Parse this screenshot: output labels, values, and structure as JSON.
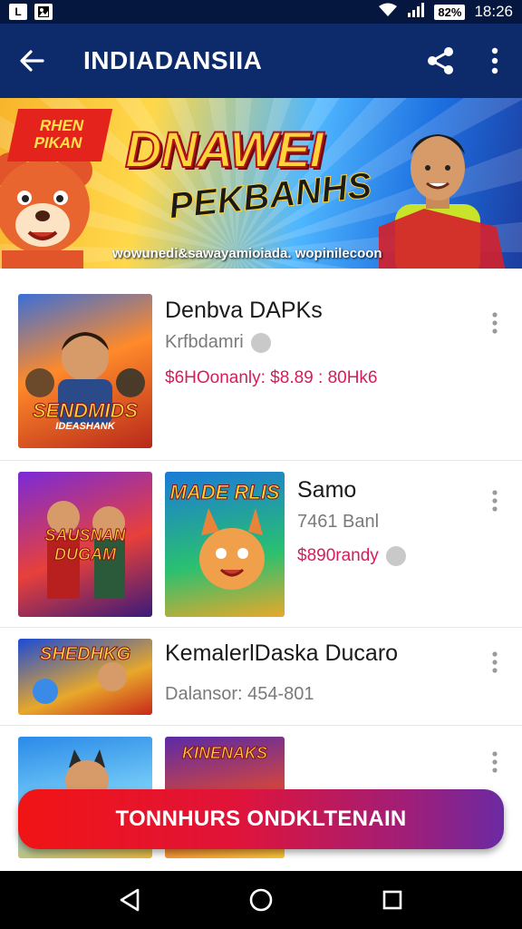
{
  "status_bar": {
    "left_icons": [
      "L",
      "photo-icon"
    ],
    "battery": "82%",
    "time": "18:26"
  },
  "app_bar": {
    "title": "INDIADANSIIA",
    "icons": [
      "back-arrow-icon",
      "share-icon",
      "more-vert-icon"
    ]
  },
  "banner": {
    "tag": "RHEN PIKAN",
    "title": "DNAWEI",
    "subtitle": "PEKBANHS",
    "url": "wowunedi&sawayamioiada. wopinilecoon"
  },
  "games": [
    {
      "thumb_label": "SENDMIDS",
      "thumb_sub": "IDEASHANK",
      "title": "Denbva DAPKs",
      "subtitle": "Krfbdamri",
      "price": "$6HOonanly: $8.89 : 80Hk6"
    },
    {
      "thumb_labels": [
        "SAUSNAN DUGAM",
        "MADE RLIS"
      ],
      "title": "Samo",
      "subtitle": "7461 Banl",
      "price": "$890randy"
    },
    {
      "thumb_label": "SHEDHKG",
      "title": "KemalerlDaska Ducaro",
      "subtitle": "Dalansor: 454-801"
    },
    {
      "thumb_labels": [
        "",
        "KINENAKS"
      ]
    }
  ],
  "cta": {
    "label": "TONNHURS ONDKLTENAIN"
  },
  "colors": {
    "app_bar": "#0d2a6b",
    "status_bar": "#06173f",
    "price": "#d61d5a",
    "cta_start": "#f01414",
    "cta_end": "#6b2aa2"
  }
}
